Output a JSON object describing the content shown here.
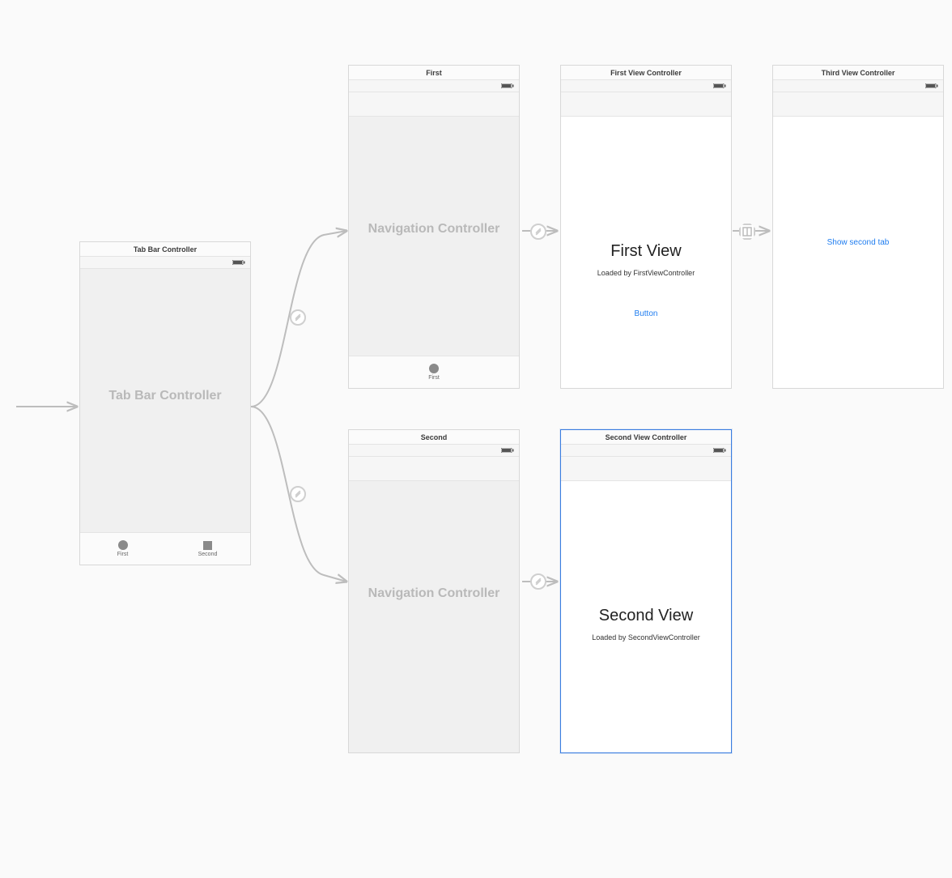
{
  "scenes": {
    "tabBar": {
      "title": "Tab Bar Controller",
      "body_label": "Tab Bar Controller",
      "tabs": [
        {
          "label": "First"
        },
        {
          "label": "Second"
        }
      ]
    },
    "nav1": {
      "title": "First",
      "body_label": "Navigation Controller",
      "tab_label": "First"
    },
    "nav2": {
      "title": "Second",
      "body_label": "Navigation Controller"
    },
    "firstVC": {
      "title": "First View Controller",
      "heading": "First View",
      "subheading": "Loaded by FirstViewController",
      "button_label": "Button"
    },
    "secondVC": {
      "title": "Second View Controller",
      "heading": "Second View",
      "subheading": "Loaded by SecondViewController"
    },
    "thirdVC": {
      "title": "Third View Controller",
      "button_label": "Show second tab"
    }
  }
}
